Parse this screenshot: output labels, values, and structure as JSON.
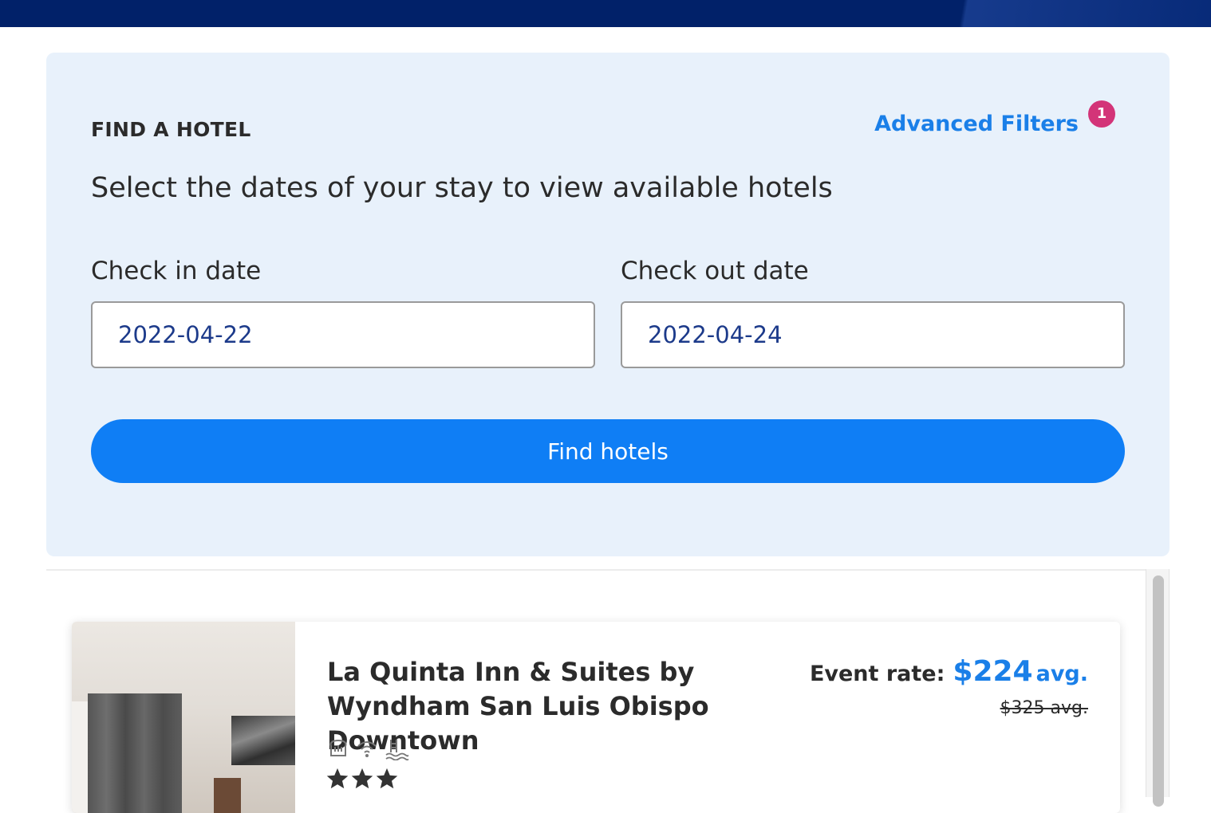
{
  "search": {
    "title": "FIND A HOTEL",
    "advanced_filters_label": "Advanced Filters",
    "filter_count": "1",
    "subtitle": "Select the dates of your stay to view available hotels",
    "check_in_label": "Check in date",
    "check_in_value": "2022-04-22",
    "check_out_label": "Check out date",
    "check_out_value": "2022-04-24",
    "find_button_label": "Find hotels"
  },
  "hotel": {
    "name": "La Quinta Inn & Suites by Wyndham San Luis Obispo Downtown",
    "rate_label": "Event rate:",
    "rate_price": "$224",
    "rate_suffix": "avg.",
    "original_rate": "$325 avg.",
    "amenities": [
      "breakfast-icon",
      "wifi-icon",
      "pool-icon"
    ],
    "star_rating": 3
  },
  "colors": {
    "header": "#012169",
    "panel_background": "#e8f1fb",
    "accent": "#1a7fe8",
    "button": "#0f7ef5",
    "badge": "#d33478"
  }
}
